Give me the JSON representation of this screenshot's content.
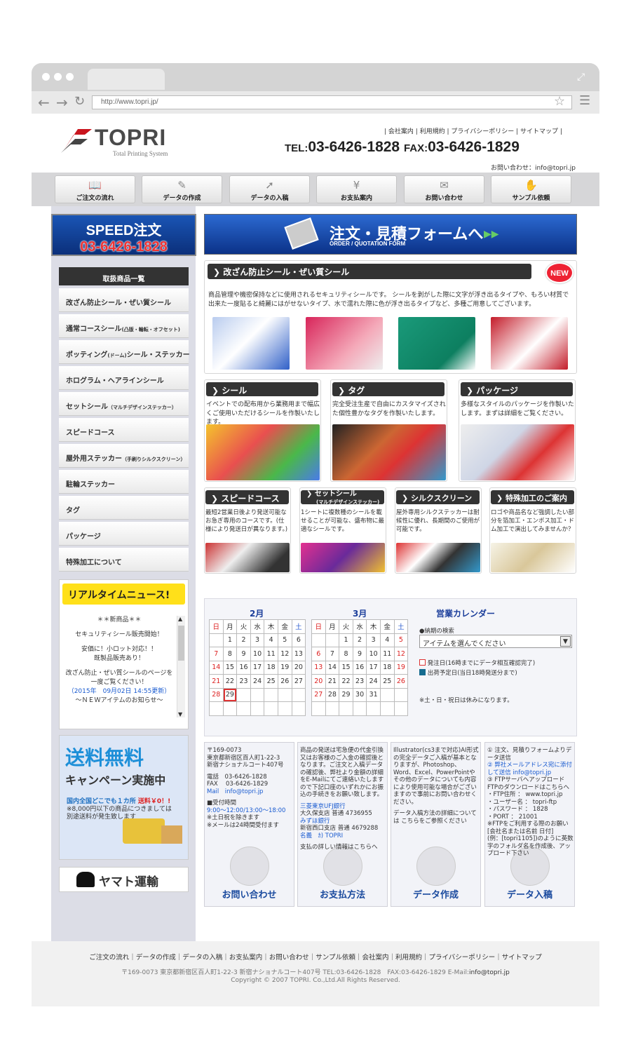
{
  "browser": {
    "url": "http://www.topri.jp/"
  },
  "header": {
    "logo_text": "TOPRI",
    "logo_sub": "Total Printing System",
    "links": "| 会社案内 | 利用規約 | プライバシーポリシー | サイトマップ |",
    "tel_label": "TEL:",
    "tel": "03-6426-1828",
    "fax_label": "FAX:",
    "fax": "03-6426-1829",
    "mail": "お問い合わせ：info@topri.jp"
  },
  "gnav": [
    {
      "label": "ご注文の流れ",
      "icon": "book-icon",
      "glyph": "📖"
    },
    {
      "label": "データの作成",
      "icon": "edit-icon",
      "glyph": "✎"
    },
    {
      "label": "データの入稿",
      "icon": "upload-arrow-icon",
      "glyph": "➚"
    },
    {
      "label": "お支払案内",
      "icon": "yen-icon",
      "glyph": "¥"
    },
    {
      "label": "お問い合わせ",
      "icon": "mail-icon",
      "glyph": "✉"
    },
    {
      "label": "サンプル依頼",
      "icon": "sample-icon",
      "glyph": "✋"
    }
  ],
  "speed": {
    "title": "SPEED注文",
    "tel": "03-6426-1828"
  },
  "order": {
    "title": "注文・見積フォームへ",
    "sub": "ORDER / QUOTATION FORM"
  },
  "sidebar": {
    "heading": "取扱商品一覧",
    "items": [
      {
        "label": "改ざん防止シール・ぜい質シール",
        "small": ""
      },
      {
        "label": "通常コースシール",
        "small": "(凸版・輪転・オフセット)"
      },
      {
        "label": "ポッティング",
        "small": "(ドーム)",
        "tail": "シール・ステッカー"
      },
      {
        "label": "ホログラム・ヘアラインシール",
        "small": ""
      },
      {
        "label": "セットシール",
        "small": "（マルチデザインステッカー）"
      },
      {
        "label": "スピードコース",
        "small": ""
      },
      {
        "label": "屋外用ステッカー",
        "small": "（手刷りシルクスクリーン）"
      },
      {
        "label": "駐輪ステッカー",
        "small": ""
      },
      {
        "label": "タグ",
        "small": ""
      },
      {
        "label": "パッケージ",
        "small": ""
      },
      {
        "label": "特殊加工について",
        "small": ""
      }
    ]
  },
  "news": {
    "title": "リアルタイムニュース!",
    "lines": [
      "＊＊新商品＊＊",
      "セキュリティシール販売開始！",
      "安価に！小ロット対応！！",
      "既製品販売あり！",
      "改ざん防止・ぜい質シールのページを",
      "一度ご覧ください！",
      "（2015年　09月02日 14:55更新）",
      "～ＮＥＷアイテムのお知らせ～"
    ]
  },
  "ship": {
    "title": "送料無料",
    "sub": "キャンペーン実施中",
    "line1": "国内全国どこでも１カ所",
    "line1b": "送料￥0！!",
    "line2": "※8,000円以下の商品につきましては",
    "line3": "別途送料が発生致します"
  },
  "yamato": "ヤマト運輸",
  "feature": {
    "title": "改ざん防止シール・ぜい質シール",
    "badge": "NEW",
    "desc": "商品管理や機密保持などに使用されるセキュリティシールです。 シールを剥がした際に文字が浮き出るタイプや、もろい材質で出来た一度貼ると綺麗にはがせないタイプ、水で濡れた際に色が浮き出るタイプなど、多種ご用意してございます。"
  },
  "row1": [
    {
      "title": "シール",
      "desc": "イベントでの配布用から業務用まで幅広くご使用いただけるシールを作製いたします。"
    },
    {
      "title": "タグ",
      "desc": "完全受注生産で自由にカスタマイズされた個性豊かなタグを作製いたします。"
    },
    {
      "title": "パッケージ",
      "desc": "多様なスタイルのパッケージを作製いたします。まずは詳細をご覧ください。"
    }
  ],
  "row2": [
    {
      "title": "スピードコース",
      "small": "",
      "desc": "最短2営業日後より発送可能なお急ぎ専用のコースです。(仕様により発送日が異なります。)"
    },
    {
      "title": "セットシール",
      "small": "(マルチデザインステッカー)",
      "desc": "1シートに複数種のシールを載せることが可能な、盛布物に最適なシールです。"
    },
    {
      "title": "シルクスクリーン",
      "small": "",
      "desc": "屋外専用シルクステッカーは耐候性に優れ、長期間のご使用が可能です。"
    },
    {
      "title": "特殊加工のご案内",
      "small": "",
      "desc": "ロゴや商品名など強調したい部分を箔加工・エンボス加工・ドム加工で演出してみませんか？"
    }
  ],
  "calendar": {
    "title": "営業カレンダー",
    "weekdays": [
      "日",
      "月",
      "火",
      "水",
      "木",
      "金",
      "土"
    ],
    "months": [
      {
        "label": "2月",
        "cells": [
          "",
          "1",
          "2",
          "3",
          "4",
          "5",
          "6",
          "7",
          "8",
          "9",
          "10",
          "11",
          "12",
          "13",
          "14",
          "15",
          "16",
          "17",
          "18",
          "19",
          "20",
          "21",
          "22",
          "23",
          "24",
          "25",
          "26",
          "27",
          "28",
          "29",
          "",
          "",
          "",
          "",
          "",
          "",
          "",
          "",
          "",
          "",
          "",
          ""
        ]
      },
      {
        "label": "3月",
        "cells": [
          "",
          "",
          "1",
          "2",
          "3",
          "4",
          "5",
          "6",
          "7",
          "8",
          "9",
          "10",
          "11",
          "12",
          "13",
          "14",
          "15",
          "16",
          "17",
          "18",
          "19",
          "20",
          "21",
          "22",
          "23",
          "24",
          "25",
          "26",
          "27",
          "28",
          "29",
          "30",
          "31",
          "",
          "",
          "",
          "",
          "",
          "",
          "",
          "",
          ""
        ]
      }
    ],
    "search_label": "●納期の検索",
    "select": "アイテムを選んでください",
    "legend1": "発注日(16時までにデータ相互確認完了)",
    "legend2": "出荷予定日(当日18時発送分まで)",
    "note": "※土・日・祝日は休みになります。"
  },
  "info": [
    {
      "btn": "お問い合わせ",
      "icon": "chat-bubble-icon",
      "lines": [
        "〒169-0073",
        "東京都新宿区百人町1-22-3",
        "新宿ナショナルコート407号",
        "",
        "電話　03-6426-1828",
        "FAX　 03-6426-1829",
        "Mail　info@topri.jp",
        "",
        "■受付時間",
        "9:00～12:00/13:00～18:00",
        "※土日祝を除きます",
        "※メールは24時間受付ます"
      ]
    },
    {
      "btn": "お支払方法",
      "icon": "check-icon",
      "lines": [
        "商品の発送は宅急便の代金引換又はお客様のご入金の確認後となります。ご注文と入稿データの確認後、弊社より金額の詳細をE-Mailにてご連絡いたしますので下記口座のいずれかにお振込の手続きをお願い致します。",
        "",
        "三菱東京UFJ銀行",
        "大久保支店 普通 4736955",
        "みずほ銀行",
        "新宿西口支店 普通 4679288",
        "名義　ｶ) TOPRI",
        "",
        "支払の詳しい情報はこちらへ"
      ]
    },
    {
      "btn": "データ作成",
      "icon": "gear-icon",
      "lines": [
        "Illustrator(cs3まで対応)AI形式の完全データご入稿が基本となりますが、Photoshop、Word、Excel、PowerPointやその他のデータについても内容により使用可能な場合がございますので事前にお問い合わせください。",
        "",
        "データ入稿方法の詳細については こちらをご参照ください"
      ]
    },
    {
      "btn": "データ入稿",
      "icon": "share-arrow-icon",
      "lines": [
        "① 注文、見積りフォームよりデータ送信",
        "② 弊社メールアドレス宛に添付して送信 info@topri.jp",
        "③ FTPサーバへアップロード",
        "FTPのダウンロードはこちらへ",
        "・FTP住所 ： www.topri.jp",
        "・ユーザー名 ： topri-ftp",
        "・パスワード ： 1828",
        "・PORT ： 21001",
        "※FTPをご利用する際のお願い",
        "[会社名または名前 日付]",
        "(例：[topri1105])のように英数字のフォルダ名を作成後、アップロード下さい"
      ]
    }
  ],
  "footer": {
    "nav": "ご注文の流れ｜データの作成｜データの入稿｜お支払案内｜お問い合わせ｜サンプル依頼｜会社案内｜利用規約｜プライバシーポリシー｜サイトマップ",
    "addr": "〒169-0073 東京都新宿区百人町1-22-3 新宿ナショナルコート407号 TEL:03-6426-1828　FAX:03-6426-1829 E-Mail:",
    "mail": "info@topri.jp",
    "copy": "Copyright © 2007 TOPRI. Co.,Ltd.All Rights Reserved."
  }
}
